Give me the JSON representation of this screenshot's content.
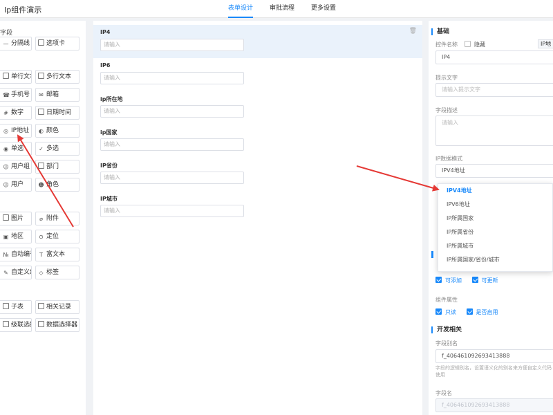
{
  "app": {
    "title": "Ip组件演示"
  },
  "tabs": [
    {
      "label": "表单设计",
      "active": true
    },
    {
      "label": "审批流程",
      "active": false
    },
    {
      "label": "更多设置",
      "active": false
    }
  ],
  "palette": {
    "group1_title": "字段",
    "group1": [
      {
        "label": "分隔线",
        "icon": "divider-icon"
      },
      {
        "label": "选项卡",
        "icon": "tab-icon"
      },
      {
        "label": "单行文本",
        "icon": "single-line-text-icon"
      },
      {
        "label": "多行文本",
        "icon": "multi-line-text-icon"
      },
      {
        "label": "手机号",
        "icon": "phone-icon"
      },
      {
        "label": "邮箱",
        "icon": "mail-icon"
      },
      {
        "label": "数字",
        "icon": "number-icon"
      },
      {
        "label": "日期时间",
        "icon": "calendar-icon"
      },
      {
        "label": "IP地址",
        "icon": "ip-icon"
      },
      {
        "label": "颜色",
        "icon": "palette-icon"
      },
      {
        "label": "单选",
        "icon": "radio-icon"
      },
      {
        "label": "多选",
        "icon": "checkbox-icon"
      },
      {
        "label": "用户组",
        "icon": "user-group-icon"
      },
      {
        "label": "部门",
        "icon": "department-icon"
      },
      {
        "label": "用户",
        "icon": "user-icon"
      },
      {
        "label": "角色",
        "icon": "role-icon"
      }
    ],
    "group2": [
      {
        "label": "图片",
        "icon": "image-icon"
      },
      {
        "label": "附件",
        "icon": "attachment-icon"
      },
      {
        "label": "地区",
        "icon": "region-icon"
      },
      {
        "label": "定位",
        "icon": "location-icon"
      },
      {
        "label": "自动编号",
        "icon": "auto-number-icon"
      },
      {
        "label": "富文本",
        "icon": "rich-text-icon"
      },
      {
        "label": "自定义组件",
        "icon": "custom-component-icon"
      },
      {
        "label": "标签",
        "icon": "tag-icon"
      }
    ],
    "group3": [
      {
        "label": "子表",
        "icon": "sub-table-icon"
      },
      {
        "label": "相关记录",
        "icon": "related-records-icon"
      },
      {
        "label": "级联选择器",
        "icon": "cascader-icon"
      },
      {
        "label": "数据选择器",
        "icon": "data-selector-icon"
      }
    ]
  },
  "form": {
    "fields": [
      {
        "label": "IP4",
        "placeholder": "请输入",
        "selected": true
      },
      {
        "label": "IP6",
        "placeholder": "请输入",
        "selected": false
      },
      {
        "label": "ip所在地",
        "placeholder": "请输入",
        "selected": false
      },
      {
        "label": "ip国家",
        "placeholder": "请输入",
        "selected": false
      },
      {
        "label": "IP省份",
        "placeholder": "请输入",
        "selected": false
      },
      {
        "label": "IP城市",
        "placeholder": "请输入",
        "selected": false
      }
    ]
  },
  "props": {
    "basic_title": "基础",
    "control_name_label": "控件名称",
    "hide_label": "隐藏",
    "type_tag": "IP地",
    "control_name_value": "IP4",
    "hint_label": "提示文字",
    "hint_placeholder": "请输入提示文字",
    "desc_label": "字段描述",
    "desc_placeholder": "请输入",
    "mode_label": "IP数据模式",
    "mode_value": "IPV4地址",
    "perm_add": "可添加",
    "perm_update": "可更新",
    "attr_label": "组件属性",
    "attr_readonly": "只读",
    "attr_enabled": "是否启用",
    "dev_title": "开发相关",
    "alias_label": "字段别名",
    "alias_value": "f_406461092693413888",
    "alias_help": "字段的逻辑别名，设置语义化的别名来方便自定义代码使用",
    "field_name_label": "字段名",
    "field_name_value": "f_406461092693413888"
  },
  "dropdown": {
    "options": [
      {
        "label": "IPV4地址",
        "selected": true
      },
      {
        "label": "IPV6地址",
        "selected": false
      },
      {
        "label": "IP所属国家",
        "selected": false
      },
      {
        "label": "IP所属省份",
        "selected": false
      },
      {
        "label": "IP所属城市",
        "selected": false
      },
      {
        "label": "IP所属国家/省份/城市",
        "selected": false
      }
    ]
  },
  "colors": {
    "accent": "#1989fa",
    "arrow": "#e53935"
  }
}
